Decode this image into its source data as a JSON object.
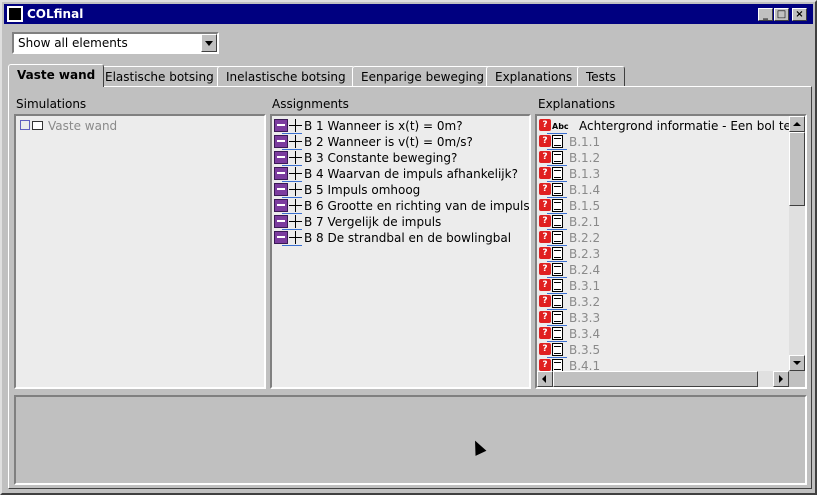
{
  "window": {
    "title": "COLfinal"
  },
  "filter": {
    "value": "Show all elements"
  },
  "tabs": [
    "Vaste wand",
    "Elastische botsing",
    "Inelastische botsing",
    "Eenparige beweging",
    "Explanations",
    "Tests"
  ],
  "panels": {
    "simulations": "Simulations",
    "assignments": "Assignments",
    "explanations": "Explanations"
  },
  "simulations": [
    "Vaste wand"
  ],
  "assignments": [
    "B 1 Wanneer is x(t) = 0m?",
    "B 2 Wanneer is v(t) = 0m/s?",
    "B 3 Constante beweging?",
    "B 4 Waarvan de impuls afhankelijk?",
    "B 5 Impuls omhoog",
    "B 6 Grootte en richting van de impuls",
    "B 7 Vergelijk de impuls",
    "B 8 De strandbal en de bowlingbal"
  ],
  "explanations": {
    "header": "Achtergrond informatie - Een bol tege",
    "abc": "Abc",
    "items": [
      "B.1.1",
      "B.1.2",
      "B.1.3",
      "B.1.4",
      "B.1.5",
      "B.2.1",
      "B.2.2",
      "B.2.3",
      "B.2.4",
      "B.3.1",
      "B.3.2",
      "B.3.3",
      "B.3.4",
      "B.3.5",
      "B.4.1"
    ]
  },
  "colors": {
    "titlebar": "#000080",
    "face": "#c0c0c0",
    "icon_red": "#e02020",
    "icon_purple": "#7b3c9e"
  }
}
